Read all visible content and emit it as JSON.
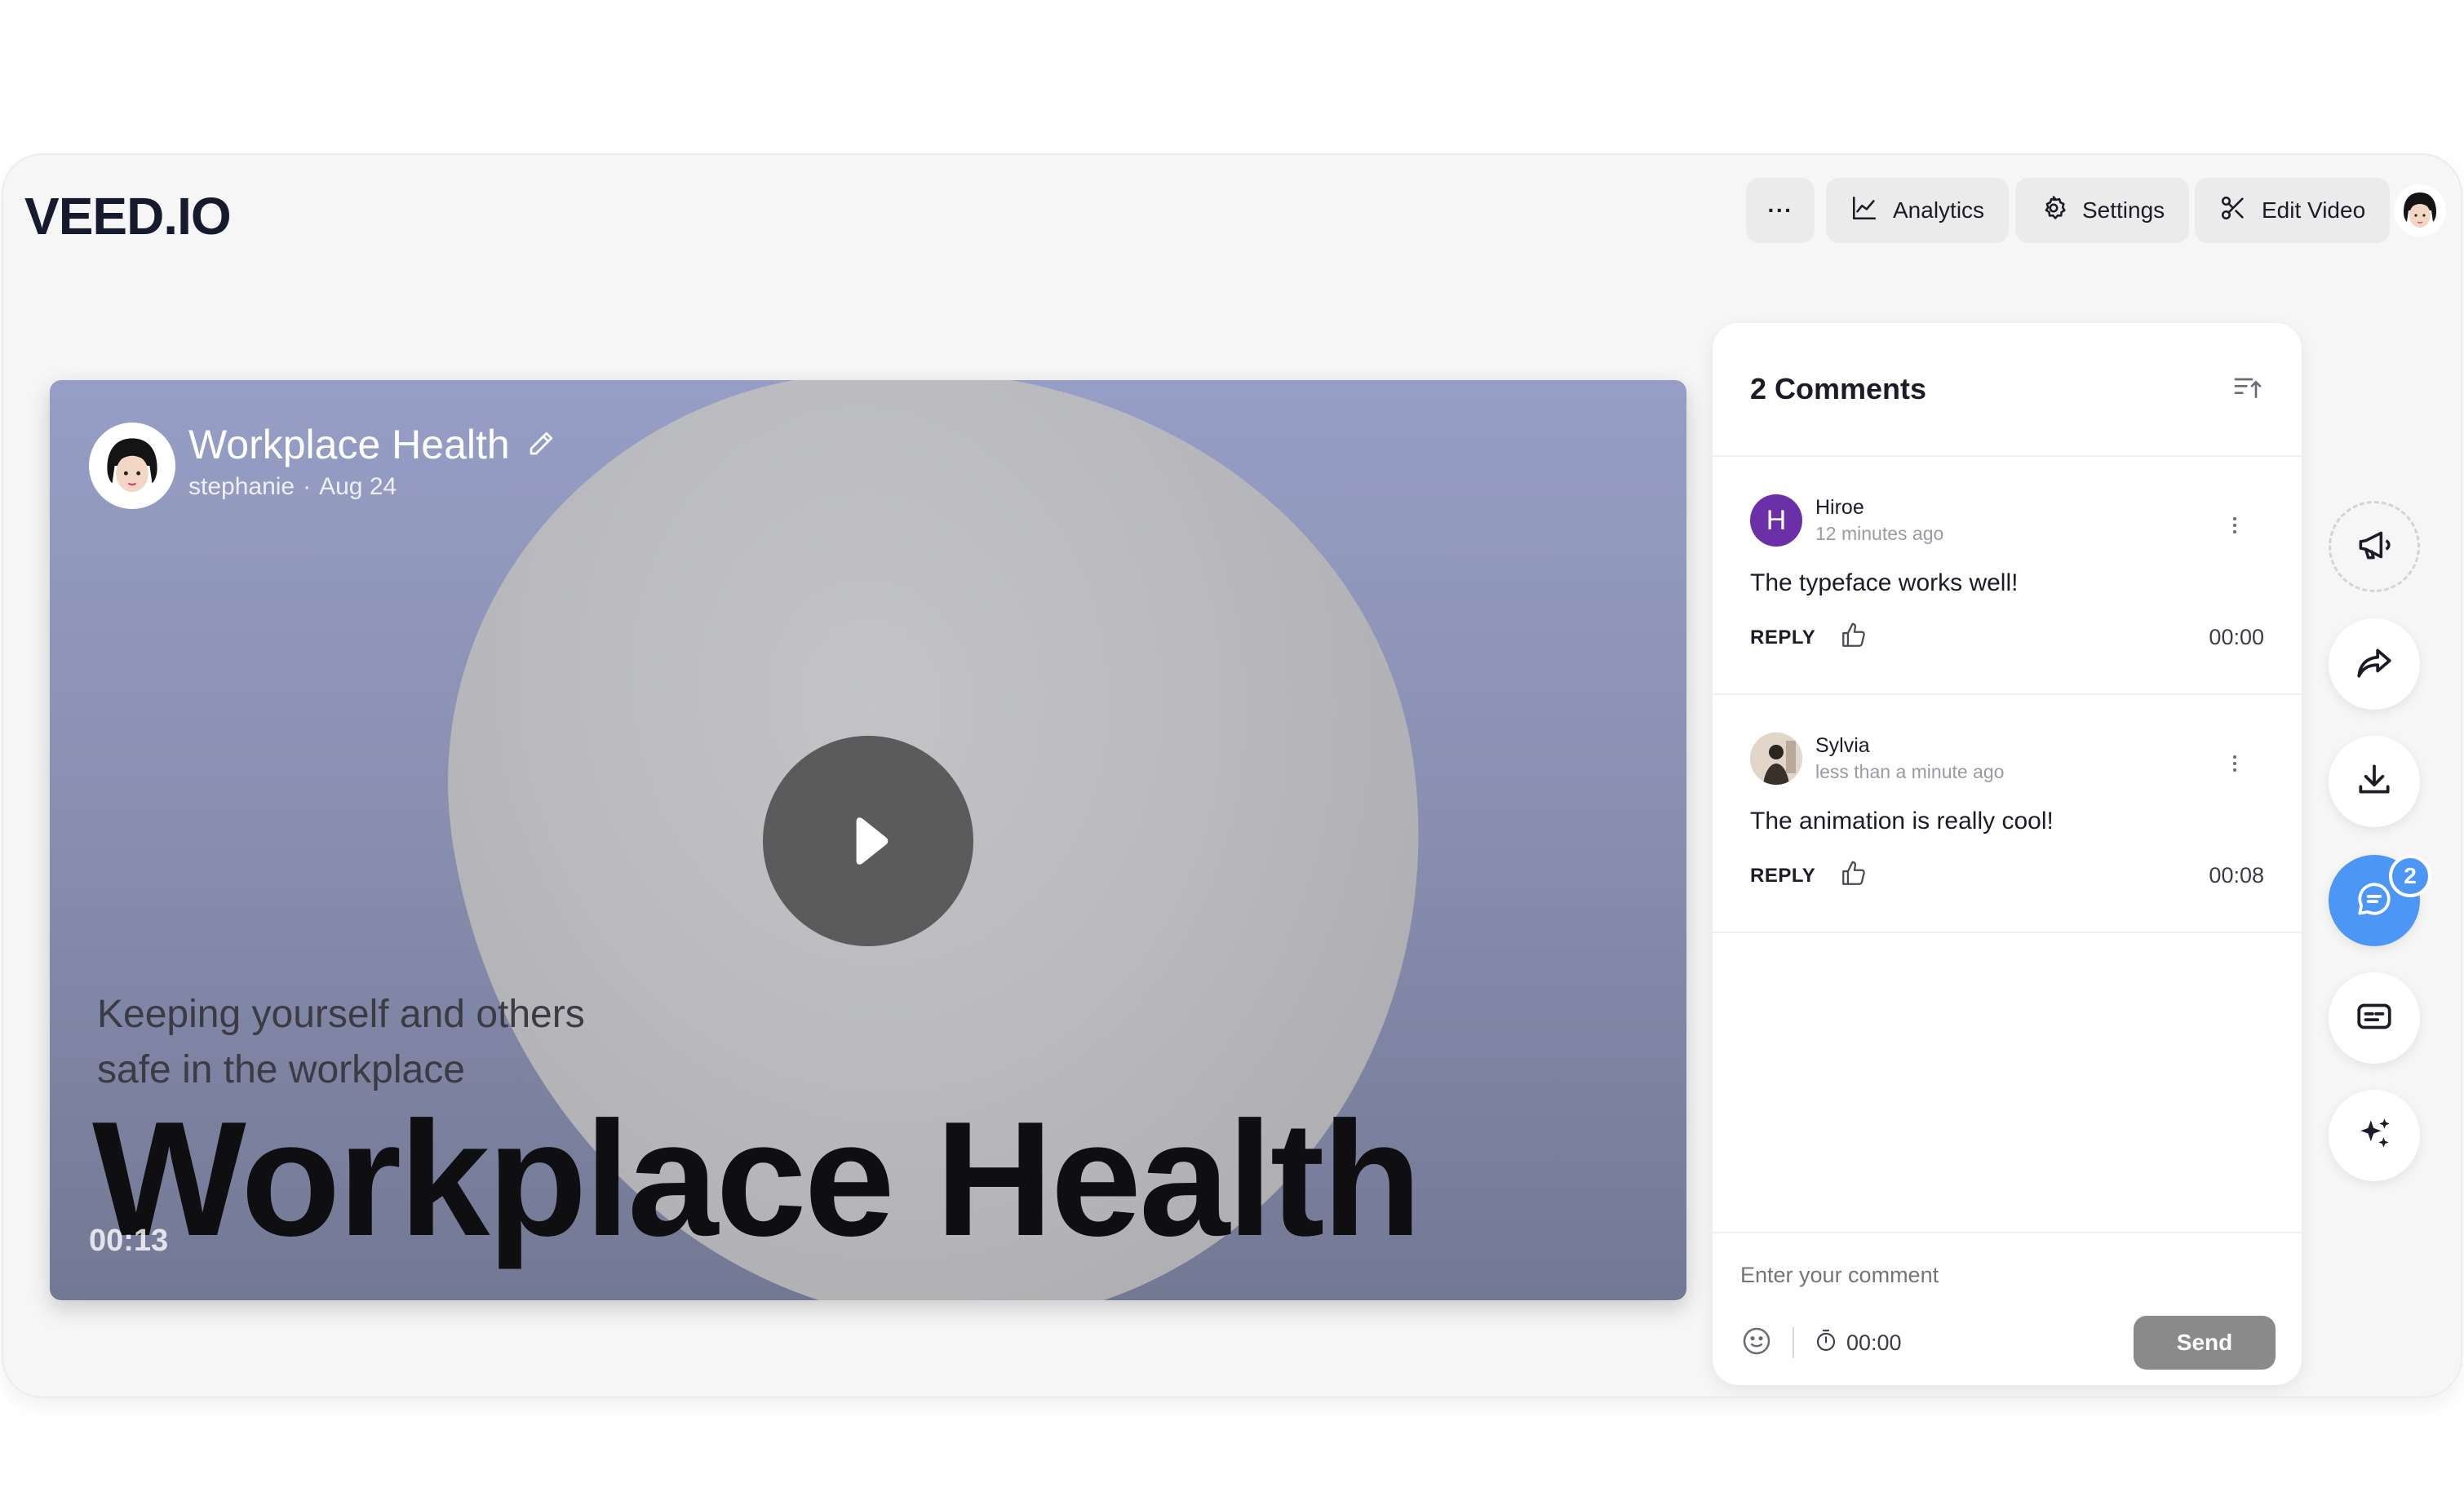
{
  "app": {
    "logo": "VEED.IO"
  },
  "topbar": {
    "more_label": "···",
    "analytics_label": "Analytics",
    "settings_label": "Settings",
    "edit_label": "Edit Video"
  },
  "video": {
    "title": "Workplace Health",
    "author": "stephanie",
    "date": "Aug 24",
    "tagline_line1": "Keeping yourself and others",
    "tagline_line2": "safe in the workplace",
    "big_title": "Workplace Health",
    "timecode": "00:13"
  },
  "comments_panel": {
    "title": "2 Comments",
    "comments": [
      {
        "initial": "H",
        "name": "Hiroe",
        "time": "12 minutes ago",
        "text": "The typeface works well!",
        "reply": "REPLY",
        "stamp": "00:00",
        "avatar_color": "#6b2fa8"
      },
      {
        "initial": "",
        "name": "Sylvia",
        "time": "less than a minute ago",
        "text": "The animation is really cool!",
        "reply": "REPLY",
        "stamp": "00:08",
        "avatar_color": "#c9b8a8"
      }
    ],
    "composer": {
      "placeholder": "Enter your comment",
      "timestamp": "00:00",
      "send_label": "Send"
    }
  },
  "sidebar": {
    "comments_badge": "2"
  },
  "colors": {
    "accent": "#4c96f5",
    "send_button": "#8a8a8a"
  },
  "icons": [
    "more-icon",
    "analytics-icon",
    "settings-icon",
    "scissors-icon",
    "pencil-icon",
    "play-icon",
    "sort-icon",
    "kebab-icon",
    "thumbs-up-icon",
    "emoji-icon",
    "stopwatch-icon",
    "megaphone-icon",
    "share-icon",
    "download-icon",
    "comment-icon",
    "subtitles-icon",
    "sparkle-icon"
  ]
}
